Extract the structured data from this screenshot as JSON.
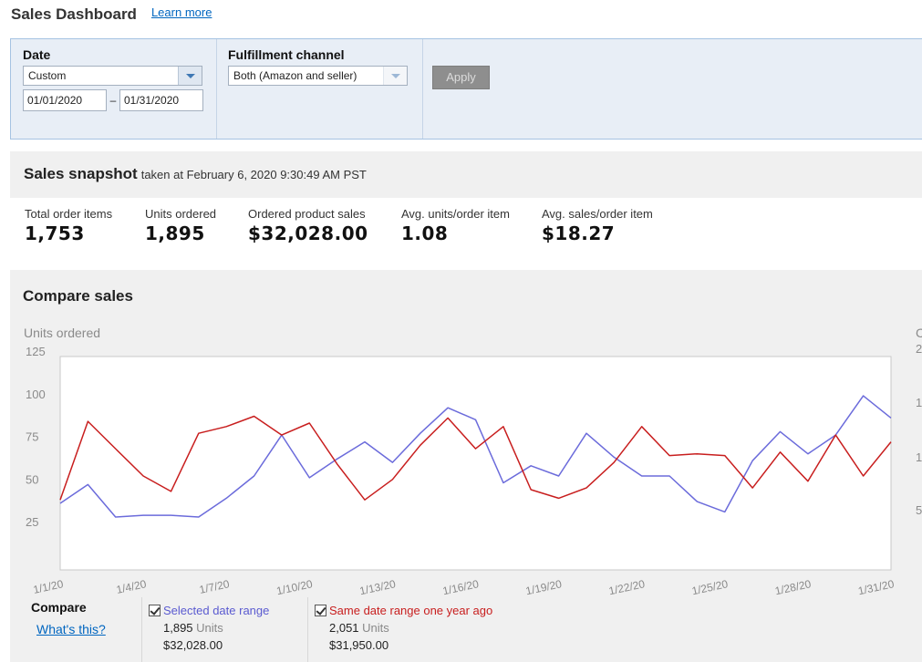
{
  "header": {
    "title": "Sales Dashboard",
    "learn_more": "Learn more"
  },
  "filters": {
    "date_label": "Date",
    "date_select": "Custom",
    "start_date": "01/01/2020",
    "date_separator": "–",
    "end_date": "01/31/2020",
    "channel_label": "Fulfillment channel",
    "channel_select": "Both (Amazon and seller)",
    "apply": "Apply"
  },
  "snapshot": {
    "title": "Sales snapshot",
    "subtitle": "taken at February 6, 2020 9:30:49 AM PST",
    "metrics": [
      {
        "label": "Total order items",
        "value": "1,753"
      },
      {
        "label": "Units ordered",
        "value": "1,895"
      },
      {
        "label": "Ordered product sales",
        "value": "$32,028.00"
      },
      {
        "label": "Avg. units/order item",
        "value": "1.08"
      },
      {
        "label": "Avg. sales/order item",
        "value": "$18.27"
      }
    ]
  },
  "compare": {
    "title": "Compare sales",
    "label": "Compare",
    "whats_this": "What's this?",
    "legend": [
      {
        "label": "Selected date range",
        "units": "1,895",
        "units_word": "Units",
        "sales": "$32,028.00",
        "color": "#6b6bdb",
        "checked": true
      },
      {
        "label": "Same date range one year ago",
        "units": "2,051",
        "units_word": "Units",
        "sales": "$31,950.00",
        "color": "#c81e1e",
        "checked": true
      }
    ]
  },
  "chart_data": {
    "type": "line",
    "ylabel": "Units ordered",
    "right_axis_label_partial": "C",
    "right_ticks_partial": [
      "2",
      "1",
      "1",
      "5"
    ],
    "ylim": [
      0,
      125
    ],
    "yticks": [
      25,
      50,
      75,
      100,
      125
    ],
    "grid": false,
    "x_tick_labels": [
      "1/1/20",
      "1/4/20",
      "1/7/20",
      "1/10/20",
      "1/13/20",
      "1/16/20",
      "1/19/20",
      "1/22/20",
      "1/25/20",
      "1/28/20",
      "1/31/20"
    ],
    "x": [
      "1/1/20",
      "1/2/20",
      "1/3/20",
      "1/4/20",
      "1/5/20",
      "1/6/20",
      "1/7/20",
      "1/8/20",
      "1/9/20",
      "1/10/20",
      "1/11/20",
      "1/12/20",
      "1/13/20",
      "1/14/20",
      "1/15/20",
      "1/16/20",
      "1/17/20",
      "1/18/20",
      "1/19/20",
      "1/20/20",
      "1/21/20",
      "1/22/20",
      "1/23/20",
      "1/24/20",
      "1/25/20",
      "1/26/20",
      "1/27/20",
      "1/28/20",
      "1/29/20",
      "1/30/20",
      "1/31/20"
    ],
    "series": [
      {
        "name": "Selected date range",
        "color": "#6b6bdb",
        "values": [
          39,
          50,
          31,
          32,
          32,
          31,
          42,
          55,
          79,
          54,
          65,
          75,
          63,
          80,
          95,
          88,
          51,
          61,
          55,
          80,
          66,
          55,
          55,
          40,
          34,
          64,
          81,
          68,
          79,
          102,
          89
        ]
      },
      {
        "name": "Same date range one year ago",
        "color": "#c81e1e",
        "values": [
          41,
          87,
          71,
          55,
          46,
          80,
          84,
          90,
          79,
          86,
          62,
          41,
          53,
          73,
          89,
          71,
          84,
          47,
          42,
          48,
          63,
          84,
          67,
          68,
          67,
          48,
          69,
          52,
          79,
          55,
          75
        ]
      }
    ]
  }
}
